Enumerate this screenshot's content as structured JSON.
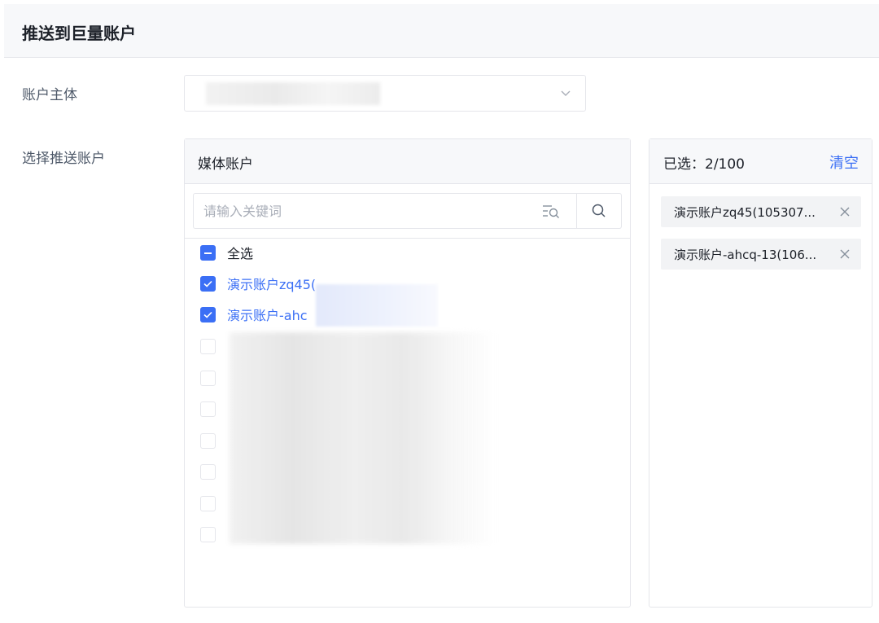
{
  "header": {
    "title": "推送到巨量账户"
  },
  "form": {
    "subject_label": "账户主体",
    "subject_value": "",
    "push_label": "选择推送账户"
  },
  "media_panel": {
    "title": "媒体账户",
    "search_placeholder": "请输入关键词",
    "select_all_label": "全选",
    "items": [
      {
        "label": "演示账户zq45(",
        "checked": true
      },
      {
        "label": "演示账户-ahc",
        "checked": true
      },
      {
        "label": "",
        "checked": false
      },
      {
        "label": "",
        "checked": false
      },
      {
        "label": "",
        "checked": false
      },
      {
        "label": "",
        "checked": false
      },
      {
        "label": "",
        "checked": false
      },
      {
        "label": "",
        "checked": false
      },
      {
        "label": "",
        "checked": false
      }
    ]
  },
  "selected_panel": {
    "count_label": "已选：2/100",
    "clear_label": "清空",
    "tags": [
      {
        "label": "演示账户zq45(105307..."
      },
      {
        "label": "演示账户-ahcq-13(106..."
      }
    ]
  },
  "colors": {
    "accent": "#3b6ff5",
    "border": "#e5e6eb",
    "header_bg": "#f7f8fa"
  }
}
